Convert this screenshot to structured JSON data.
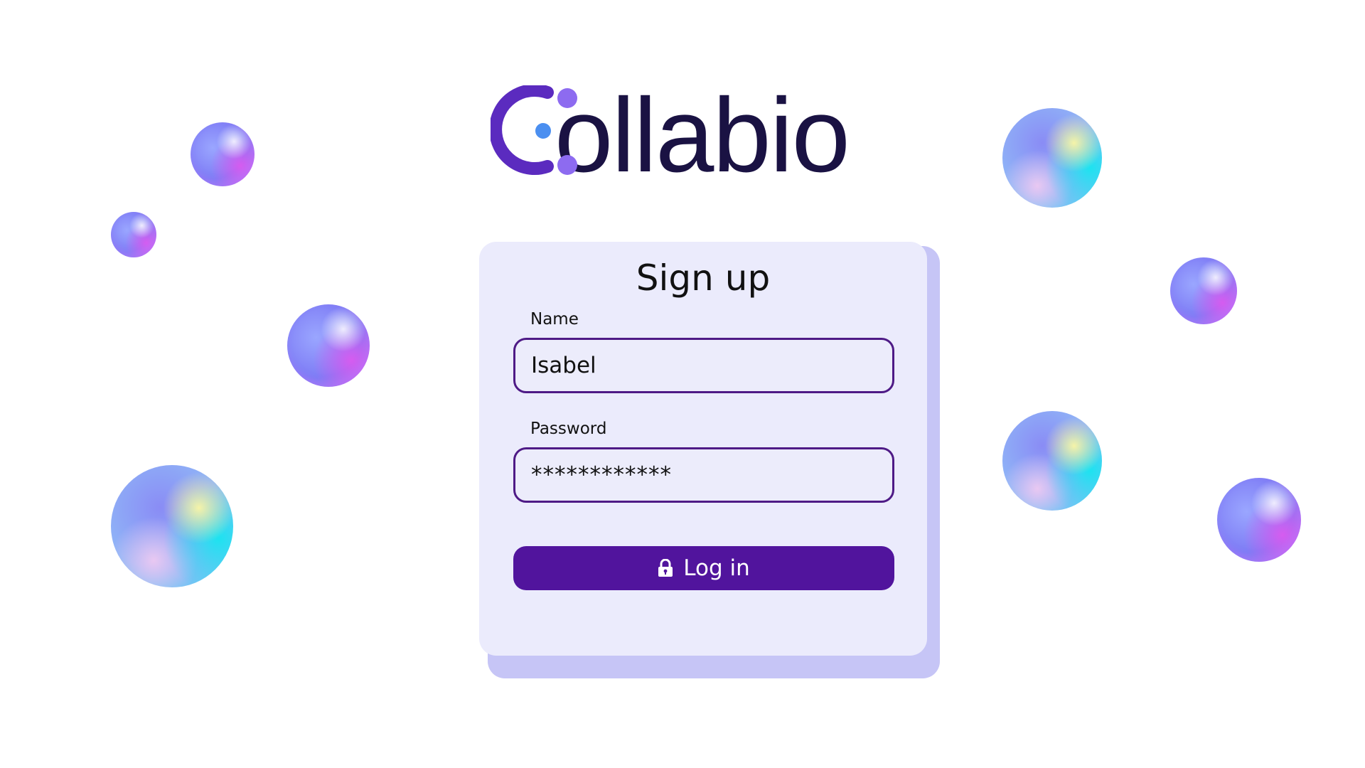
{
  "brand": {
    "name": "Collabio",
    "wordmark": "ollabio",
    "colors": {
      "mark_purple": "#5b2bbf",
      "dot_blue": "#4b8ff0",
      "dot_violet": "#8d6bf0",
      "word": "#1a1243"
    }
  },
  "form": {
    "title": "Sign up",
    "name_label": "Name",
    "name_value": "Isabel",
    "password_label": "Password",
    "password_value": "************",
    "submit_label": "Log in",
    "submit_icon": "lock-icon"
  },
  "colors": {
    "card_bg": "#ebebfc",
    "card_shadow": "#c6c5f6",
    "input_border": "#4e1a86",
    "button_bg": "#51149d"
  },
  "decorations": {
    "bubble_styles": [
      "purple",
      "cyan"
    ]
  }
}
